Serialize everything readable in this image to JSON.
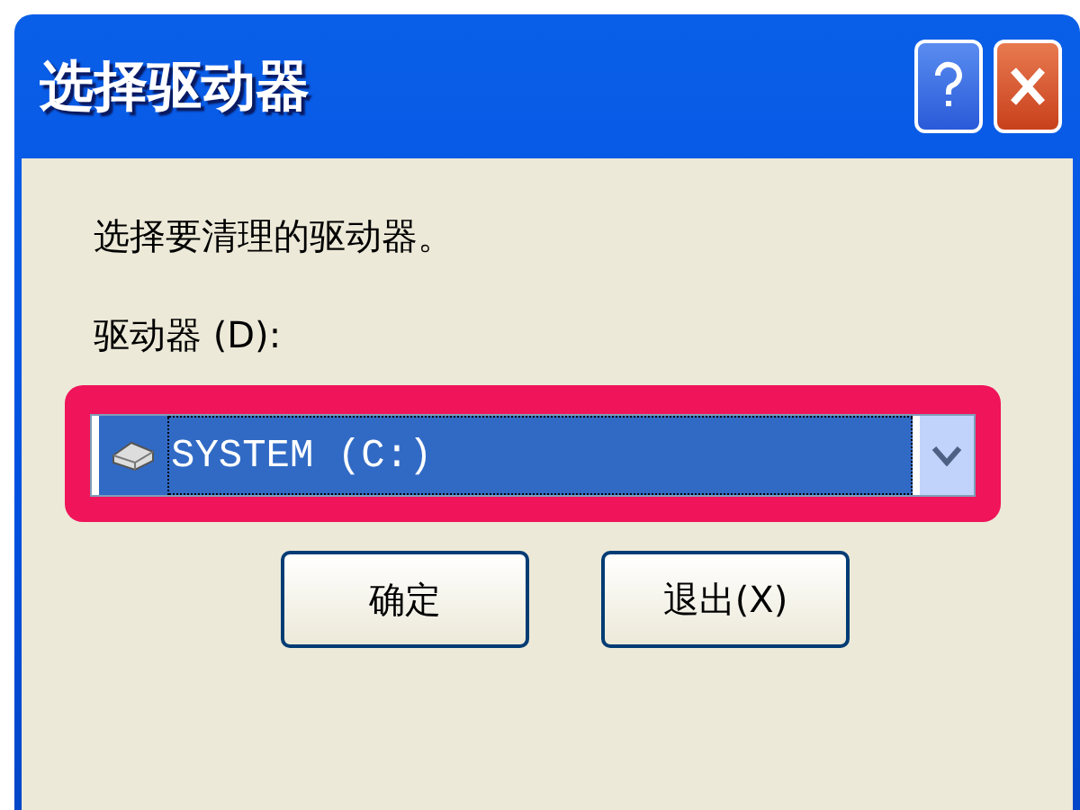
{
  "window": {
    "title": "选择驱动器"
  },
  "instruction": "选择要清理的驱动器。",
  "drive_label": "驱动器 (D):",
  "drive_select": {
    "value": "SYSTEM (C:)",
    "highlighted": true
  },
  "buttons": [
    {
      "label": "确定"
    },
    {
      "label": "退出(X)"
    }
  ]
}
